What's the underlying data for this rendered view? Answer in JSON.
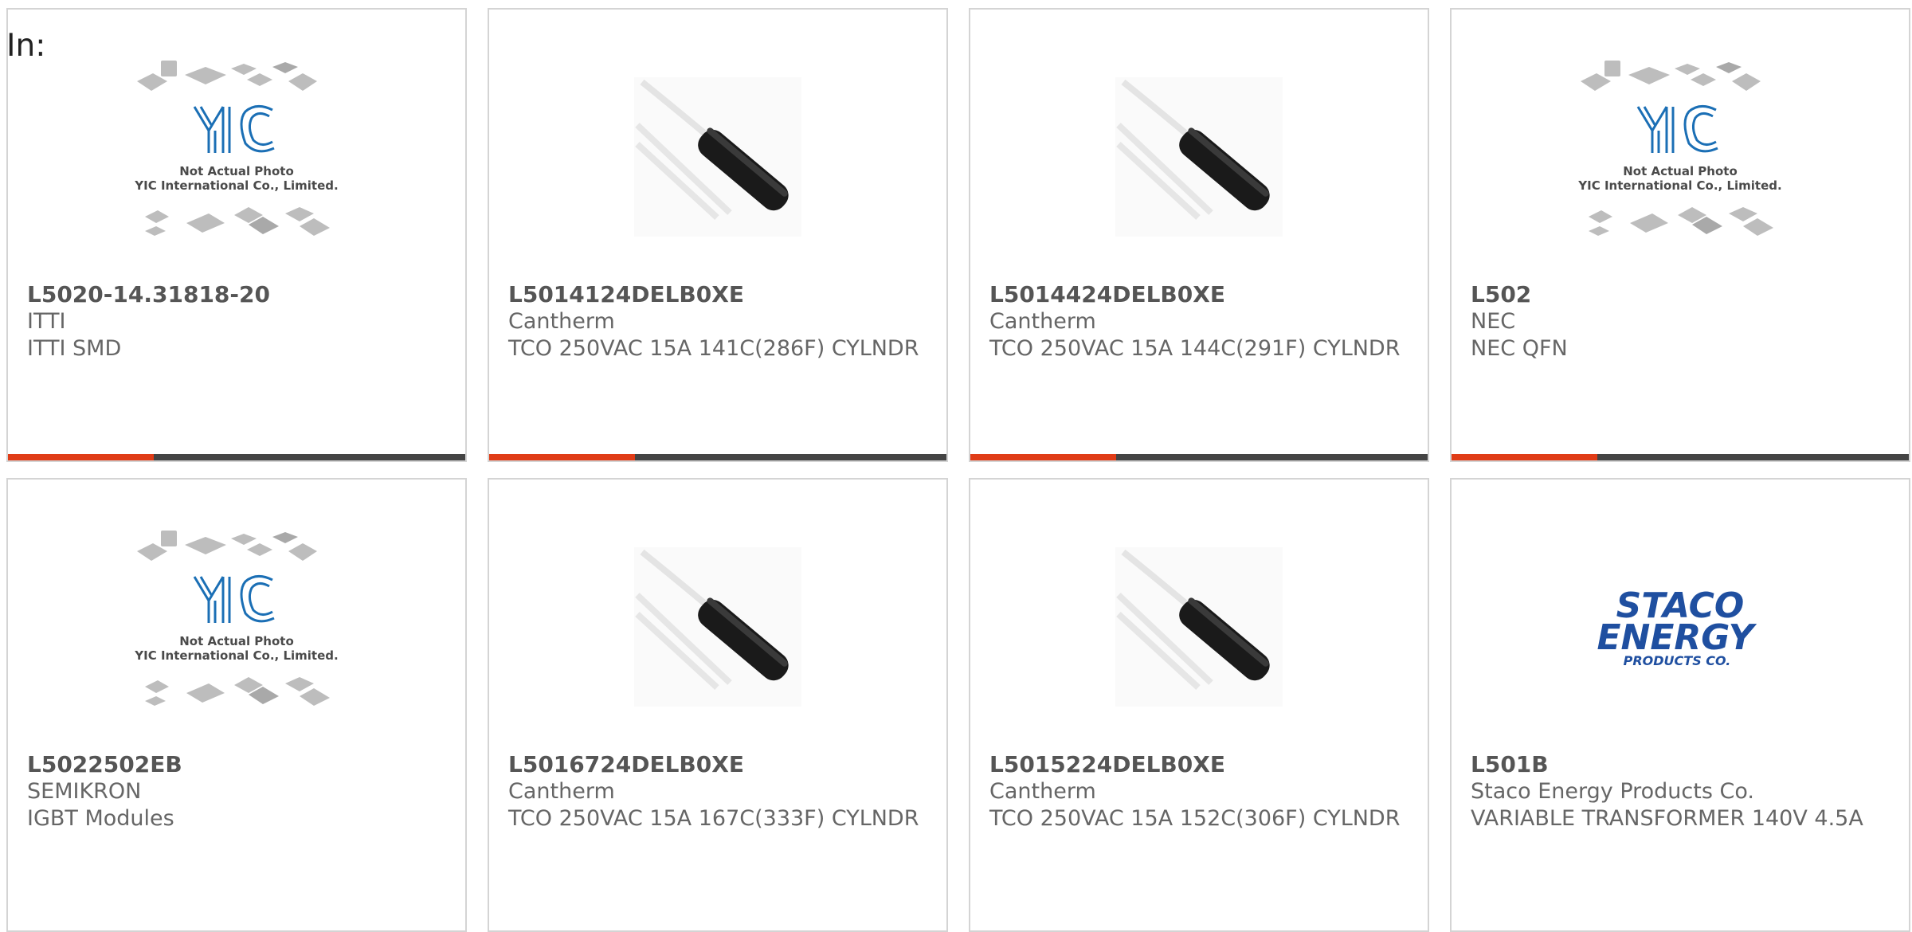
{
  "header": {
    "in_label": "In:"
  },
  "products": [
    {
      "part": "L5020-14.31818-20",
      "manufacturer": "ITTI",
      "description": "ITTI SMD",
      "image": "yic-placeholder",
      "photo_text": [
        "Not Actual Photo",
        "YIC International Co., Limited."
      ]
    },
    {
      "part": "L5014124DELB0XE",
      "manufacturer": "Cantherm",
      "description": "TCO 250VAC 15A 141C(286F) CYLNDR",
      "image": "thermal-cutoff"
    },
    {
      "part": "L5014424DELB0XE",
      "manufacturer": "Cantherm",
      "description": "TCO 250VAC 15A 144C(291F) CYLNDR",
      "image": "thermal-cutoff"
    },
    {
      "part": "L502",
      "manufacturer": "NEC",
      "description": "NEC QFN",
      "image": "yic-placeholder",
      "photo_text": [
        "Not Actual Photo",
        "YIC International Co., Limited."
      ]
    },
    {
      "part": "L5022502EB",
      "manufacturer": "SEMIKRON",
      "description": "IGBT Modules",
      "image": "yic-placeholder",
      "photo_text": [
        "Not Actual Photo",
        "YIC International Co., Limited."
      ]
    },
    {
      "part": "L5016724DELB0XE",
      "manufacturer": "Cantherm",
      "description": "TCO 250VAC 15A 167C(333F) CYLNDR",
      "image": "thermal-cutoff"
    },
    {
      "part": "L5015224DELB0XE",
      "manufacturer": "Cantherm",
      "description": "TCO 250VAC 15A 152C(306F) CYLNDR",
      "image": "thermal-cutoff"
    },
    {
      "part": "L501B",
      "manufacturer": "Staco Energy Products Co.",
      "description": "VARIABLE TRANSFORMER 140V 4.5A",
      "image": "staco-logo",
      "logo_text": [
        "STACO",
        "ENERGY",
        "PRODUCTS CO."
      ]
    }
  ],
  "colors": {
    "accent": "#e03c17",
    "bar_dark": "#444444",
    "card_border": "#d4d4d4",
    "yic_blue": "#1b6fb5",
    "staco_blue": "#1f4fa0"
  }
}
